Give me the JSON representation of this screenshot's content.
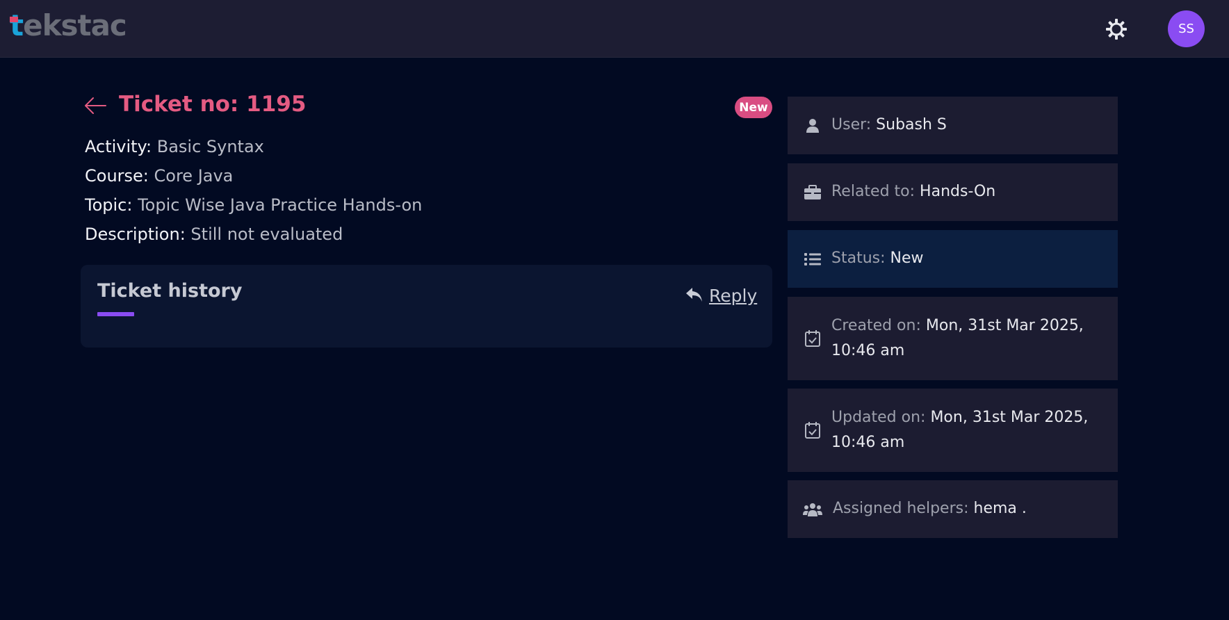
{
  "header": {
    "logo_first": "t",
    "logo_rest": "ekstac",
    "avatar_initials": "SS",
    "settings_icon": "gear-icon"
  },
  "ticket": {
    "title": "Ticket no: 1195",
    "status_badge": "New",
    "activity_label": "Activity:",
    "activity_value": "Basic Syntax",
    "course_label": "Course:",
    "course_value": "Core Java",
    "topic_label": "Topic:",
    "topic_value": "Topic Wise Java Practice Hands-on",
    "description_label": "Description:",
    "description_value": "Still not evaluated"
  },
  "history": {
    "title": "Ticket history",
    "reply_label": "Reply"
  },
  "sidebar": {
    "user_label": "User:",
    "user_value": "Subash S",
    "related_label": "Related to:",
    "related_value": "Hands-On",
    "status_label": "Status:",
    "status_value": "New",
    "created_label": "Created on:",
    "created_value": "Mon, 31st Mar 2025, 10:46 am",
    "updated_label": "Updated on:",
    "updated_value": "Mon, 31st Mar 2025, 10:46 am",
    "helpers_label": "Assigned helpers:",
    "helpers_value": "hema ."
  },
  "colors": {
    "background": "#020a22",
    "topbar": "#1d1d33",
    "accent_pink": "#e45b82",
    "accent_purple": "#8a4cf2",
    "card": "#1c1c31",
    "card_active": "#0c1f40"
  }
}
